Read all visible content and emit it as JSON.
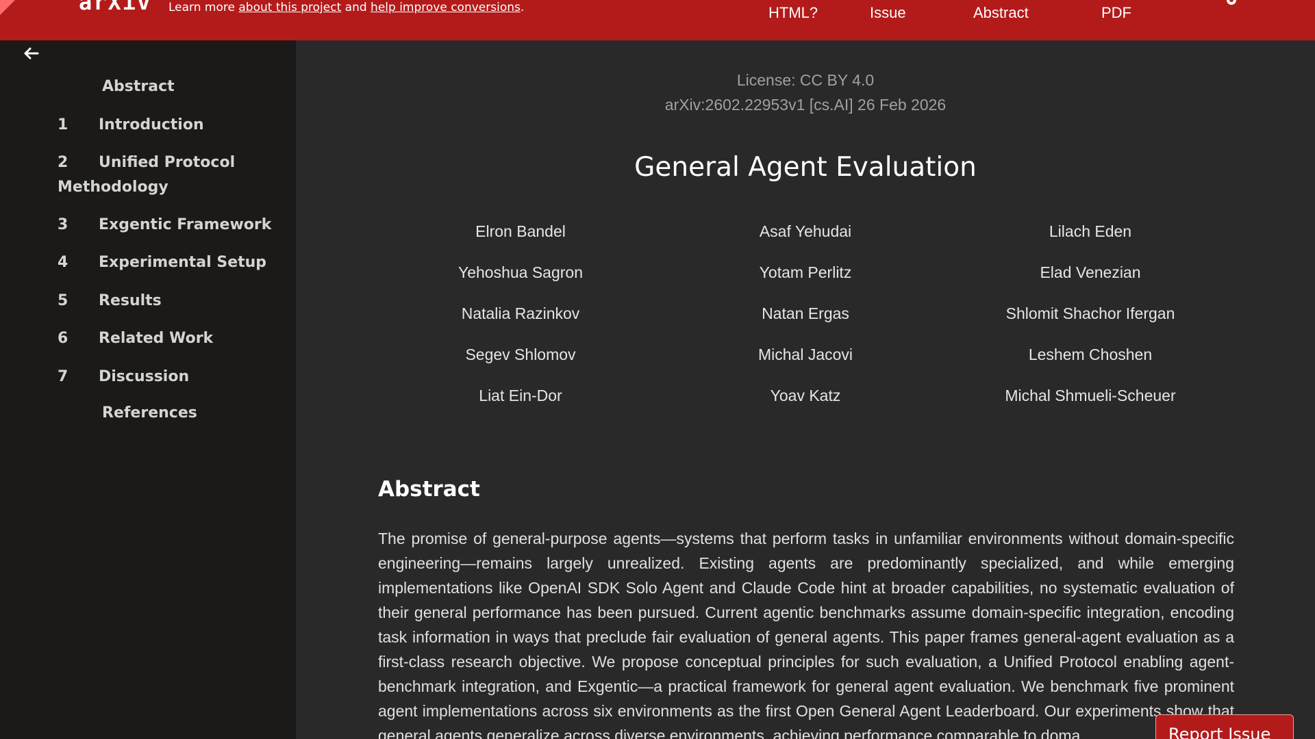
{
  "header": {
    "logo": "arXiv",
    "learn_prefix": "Learn more ",
    "learn_link1": "about this project",
    "learn_mid": " and ",
    "learn_link2": "help improve conversions",
    "learn_suffix": ".",
    "nav": [
      "HTML?",
      "Issue",
      "Abstract",
      "PDF"
    ],
    "gear_icon": "gear-icon"
  },
  "sidebar": {
    "back_icon": "arrow-left-icon",
    "items": [
      {
        "num": "",
        "label": "Abstract"
      },
      {
        "num": "1",
        "label": "Introduction"
      },
      {
        "num": "2",
        "label": "Unified Protocol",
        "label2": "Methodology"
      },
      {
        "num": "3",
        "label": "Exgentic Framework"
      },
      {
        "num": "4",
        "label": "Experimental Setup"
      },
      {
        "num": "5",
        "label": "Results"
      },
      {
        "num": "6",
        "label": "Related Work"
      },
      {
        "num": "7",
        "label": "Discussion"
      },
      {
        "num": "",
        "label": "References"
      }
    ]
  },
  "paper": {
    "license": "License: CC BY 4.0",
    "arxiv_id": "arXiv:2602.22953v1 [cs.AI] 26 Feb 2026",
    "title": "General Agent Evaluation",
    "authors": [
      "Elron Bandel",
      "Asaf Yehudai",
      "Lilach Eden",
      "Yehoshua Sagron",
      "Yotam Perlitz",
      "Elad Venezian",
      "Natalia Razinkov",
      "Natan Ergas",
      "Shlomit Shachor Ifergan",
      "Segev Shlomov",
      "Michal Jacovi",
      "Leshem Choshen",
      "Liat Ein-Dor",
      "Yoav Katz",
      "Michal Shmueli-Scheuer"
    ],
    "abstract_heading": "Abstract",
    "abstract_text": "The promise of general-purpose agents—systems that perform tasks in unfamiliar environments without domain-specific engineering—remains largely unrealized. Existing agents are predominantly specialized, and while emerging implementations like OpenAI SDK Solo Agent and Claude Code hint at broader capabilities, no systematic evaluation of their general performance has been pursued. Current agentic benchmarks assume domain-specific integration, encoding task information in ways that preclude fair evaluation of general agents. This paper frames general-agent evaluation as a first-class research objective. We propose conceptual principles for such evaluation, a Unified Protocol enabling agent-benchmark integration, and Exgentic—a practical framework for general agent evaluation. We benchmark five prominent agent implementations across six environments as the first Open General Agent Leaderboard. Our experiments show that general agents generalize across diverse environments, achieving performance comparable to doma"
  },
  "report_button": "Report Issue"
}
